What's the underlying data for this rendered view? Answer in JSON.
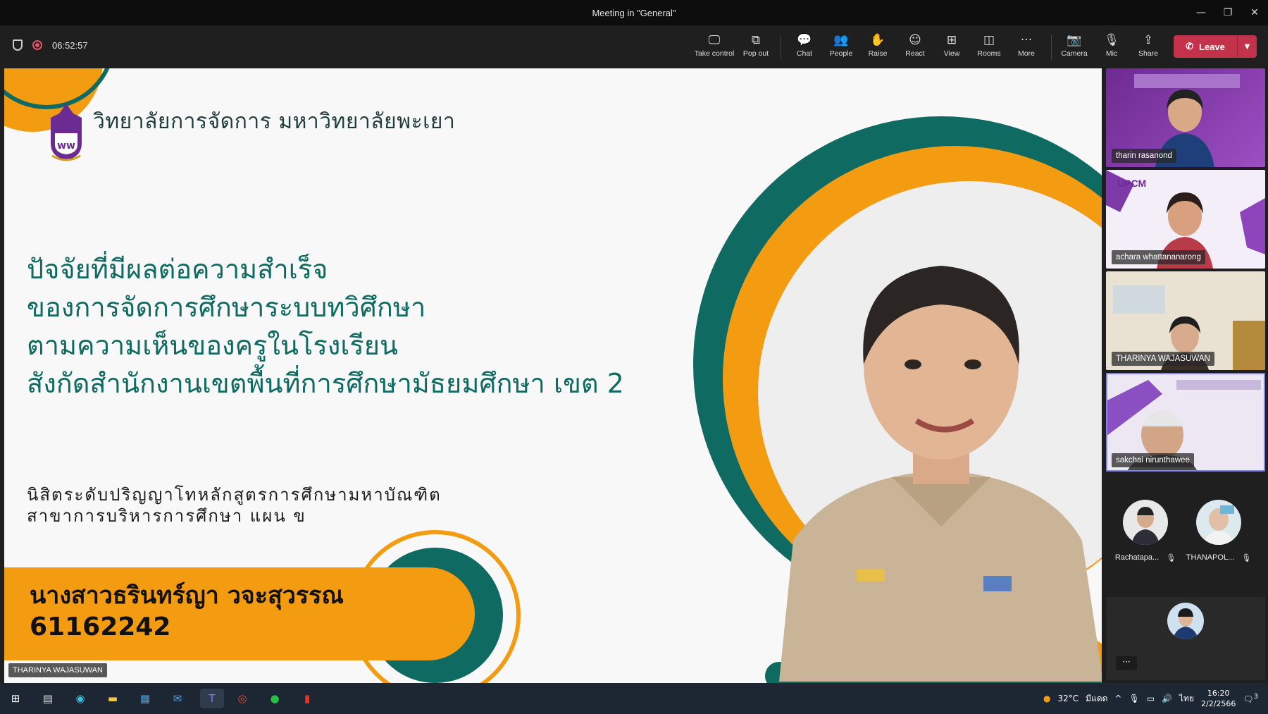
{
  "window": {
    "title": "Meeting in \"General\"",
    "minimize": "—",
    "restore": "❐",
    "close": "✕"
  },
  "toolbar": {
    "timer": "06:52:57",
    "buttons": [
      {
        "label": "Take control",
        "icon": "take-control-icon",
        "glyph": "🖵"
      },
      {
        "label": "Pop out",
        "icon": "pop-out-icon",
        "glyph": "⧉"
      },
      {
        "label": "Chat",
        "icon": "chat-icon",
        "glyph": "💬"
      },
      {
        "label": "People",
        "icon": "people-icon",
        "glyph": "👥"
      },
      {
        "label": "Raise",
        "icon": "raise-hand-icon",
        "glyph": "✋"
      },
      {
        "label": "React",
        "icon": "react-icon",
        "glyph": "☺"
      },
      {
        "label": "View",
        "icon": "view-icon",
        "glyph": "⊞"
      },
      {
        "label": "Rooms",
        "icon": "rooms-icon",
        "glyph": "◫"
      },
      {
        "label": "More",
        "icon": "more-icon",
        "glyph": "···"
      },
      {
        "label": "Camera",
        "icon": "camera-off-icon",
        "glyph": "📷"
      },
      {
        "label": "Mic",
        "icon": "mic-off-icon",
        "glyph": "🎙"
      },
      {
        "label": "Share",
        "icon": "share-icon",
        "glyph": "⇪"
      }
    ],
    "leave_label": "Leave",
    "leave_icon": "✆",
    "leave_dropdown": "▼",
    "accent": "#c4314b"
  },
  "slide": {
    "university": "วิทยาลัยการจัดการ มหาวิทยาลัยพะเยา",
    "title_lines": [
      "ปัจจัยที่มีผลต่อความสำเร็จ",
      "ของการจัดการศึกษาระบบทวิศึกษา",
      "ตามความเห็นของครูในโรงเรียน",
      "สังกัดสำนักงานเขตพื้นที่การศึกษามัธยมศึกษา เขต 2"
    ],
    "degree_lines": [
      "นิสิตระดับปริญญาโทหลักสูตรการศึกษามหาบัณฑิต",
      "สาขาการบริหารการศึกษา แผน ข"
    ],
    "student_name": "นางสาวธรินทร์ญา  วจะสุวรรณ",
    "student_id": "61162242",
    "colors": {
      "teal": "#0f6b62",
      "orange": "#f39c12"
    }
  },
  "presenter_tag": "THARINYA WAJASUWAN",
  "participants": [
    {
      "name": "tharin rasanond"
    },
    {
      "name": "achara whattananarong"
    },
    {
      "name": "THARINYA WAJASUWAN"
    },
    {
      "name": "sakchai nirunthawee"
    }
  ],
  "avatars": [
    {
      "name": "Rachatapa..."
    },
    {
      "name": "THANAPOL..."
    }
  ],
  "self_more": "···",
  "tray": {
    "temperature": "32°C",
    "weather_text": "มีแดด",
    "language": "ไทย",
    "time": "16:20",
    "date": "2/2/2566",
    "notifications": "3"
  }
}
